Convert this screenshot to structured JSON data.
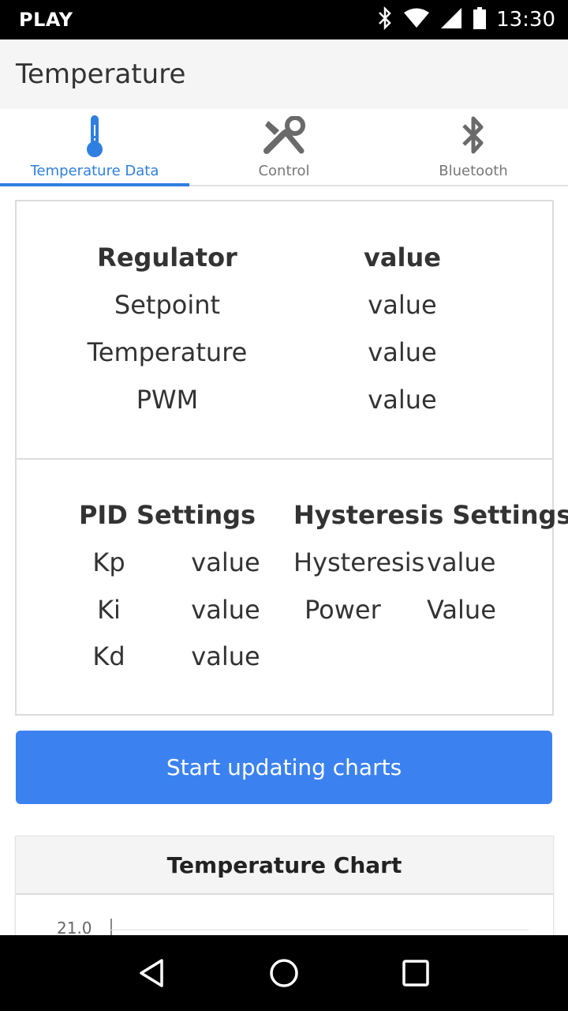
{
  "status_bar": {
    "carrier": "PLAY",
    "time": "13:30",
    "icons": [
      "bluetooth-icon",
      "wifi-icon",
      "signal-icon",
      "battery-icon"
    ]
  },
  "app_bar": {
    "title": "Temperature"
  },
  "tabs": [
    {
      "label": "Temperature Data",
      "icon": "thermometer-icon",
      "active": true
    },
    {
      "label": "Control",
      "icon": "tools-icon",
      "active": false
    },
    {
      "label": "Bluetooth",
      "icon": "bluetooth-icon",
      "active": false
    }
  ],
  "regulator": {
    "header_label": "Regulator",
    "header_value": "value",
    "rows": [
      {
        "label": "Setpoint",
        "value": "value"
      },
      {
        "label": "Temperature",
        "value": "value"
      },
      {
        "label": "PWM",
        "value": "value"
      }
    ]
  },
  "pid": {
    "title": "PID Settings",
    "rows": [
      {
        "label": "Kp",
        "value": "value"
      },
      {
        "label": "Ki",
        "value": "value"
      },
      {
        "label": "Kd",
        "value": "value"
      }
    ]
  },
  "hysteresis": {
    "title": "Hysteresis Settings",
    "rows": [
      {
        "label": "Hysteresis",
        "value": "value"
      },
      {
        "label": "Power",
        "value": "Value"
      }
    ]
  },
  "start_button": {
    "label": "Start updating charts"
  },
  "chart": {
    "title": "Temperature Chart",
    "tick_label": "21.0"
  },
  "colors": {
    "accent": "#2f7fe0",
    "button": "#3b82f0"
  }
}
